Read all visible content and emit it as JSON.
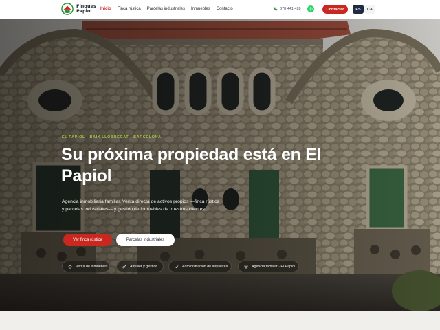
{
  "brand": {
    "line1": "Finques",
    "line2": "Papiol",
    "logo_icon": "house-flag-logo"
  },
  "menu": [
    {
      "label": "Inicio",
      "active": true
    },
    {
      "label": "Finca rústica",
      "active": false
    },
    {
      "label": "Parcelas industriales",
      "active": false
    },
    {
      "label": "Inmuebles",
      "active": false
    },
    {
      "label": "Contacto",
      "active": false
    }
  ],
  "contact": {
    "phone": "678 441 428",
    "phone_icon": "phone-icon",
    "whatsapp_icon": "whatsapp-icon",
    "cta_label": "Contactar"
  },
  "languages": {
    "es": "ES",
    "ca": "CA",
    "active": "ES"
  },
  "hero": {
    "eyebrow": "El Papiol · Baix Llobregat · Barcelona",
    "title": "Su próxima propiedad está en El Papiol",
    "lead": "Agencia inmobiliaria familiar. Venta directa de activos propios —finca rústica y parcelas industriales— y gestión de inmuebles de nuestros clientes.",
    "primary_button": "Ver finca rústica",
    "secondary_button": "Parcelas industriales"
  },
  "features": [
    {
      "label": "Venta de inmuebles",
      "icon": "home-icon"
    },
    {
      "label": "Alquiler y gestión",
      "icon": "key-icon"
    },
    {
      "label": "Administración de alquileres",
      "icon": "check-icon"
    },
    {
      "label": "Agencia familiar · El Papiol",
      "icon": "location-pin-icon"
    }
  ],
  "colors": {
    "accent": "#c8281f",
    "nav_dark": "#1f2a44",
    "eyebrow": "#a6c24a"
  }
}
